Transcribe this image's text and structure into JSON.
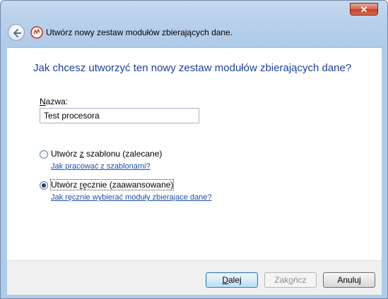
{
  "window": {
    "title": "Utwórz nowy zestaw modułów zbierających dane.",
    "close_glyph": "✕"
  },
  "heading": "Jak chcesz utworzyć ten nowy zestaw modułów zbierających dane?",
  "name_field": {
    "label_access": "N",
    "label_rest": "azwa:",
    "value": "Test procesora"
  },
  "options": [
    {
      "label_before": "Utwórz ",
      "label_access": "z",
      "label_after": " szablonu (zalecane)",
      "checked": false,
      "help_link": "Jak pracować z szablonami?"
    },
    {
      "label_before": "Utwórz ",
      "label_access": "r",
      "label_after": "ęcznie (zaawansowane)",
      "checked": true,
      "help_link": "Jak ręcznie wybierać moduły zbierajace dane?"
    }
  ],
  "buttons": {
    "next_access": "D",
    "next_rest": "alej",
    "finish_before": "Zak",
    "finish_access": "o",
    "finish_after": "ńcz",
    "cancel": "Anuluj"
  },
  "icons": {
    "back": "back-arrow-icon",
    "title": "data-collector-set-icon",
    "close": "close-icon"
  },
  "colors": {
    "heading": "#1e3f9e",
    "link": "#1c4fa8",
    "title_bar": "#b9d0ea",
    "close_button": "#c2412e"
  }
}
